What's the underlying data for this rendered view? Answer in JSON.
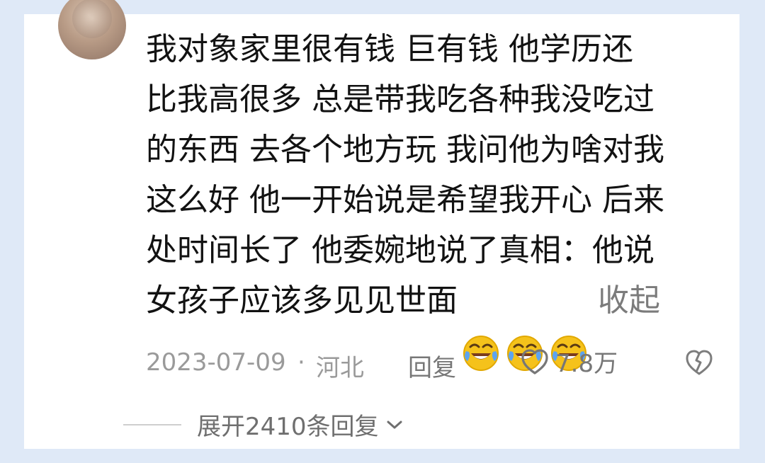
{
  "comment": {
    "text": "我对象家里很有钱 巨有钱  他学历还\n比我高很多 总是带我吃各种我没吃过\n的东西 去各个地方玩 我问他为啥对我\n这么好 他一开始说是希望我开心 后来\n处时间长了 他委婉地说了真相：他说\n女孩子应该多见见世面",
    "collapse_label": "收起"
  },
  "meta": {
    "date": "2023-07-09",
    "separator": "·",
    "location": "河北",
    "reply_label": "回复",
    "like_count": "7.8万"
  },
  "replies": {
    "expand_label": "展开2410条回复"
  },
  "icons": {
    "avatar": "avatar-image",
    "emoji": "laughing-crying-emoji",
    "like": "heart-outline-icon",
    "dislike": "broken-heart-icon",
    "expand": "chevron-down-icon"
  },
  "colors": {
    "background": "#dfe9f7",
    "card": "#ffffff",
    "text": "#121212",
    "meta": "#9a9a9a",
    "action": "#777777",
    "emoji_yellow": "#f5c21b",
    "emoji_tears": "#5da4f0"
  }
}
